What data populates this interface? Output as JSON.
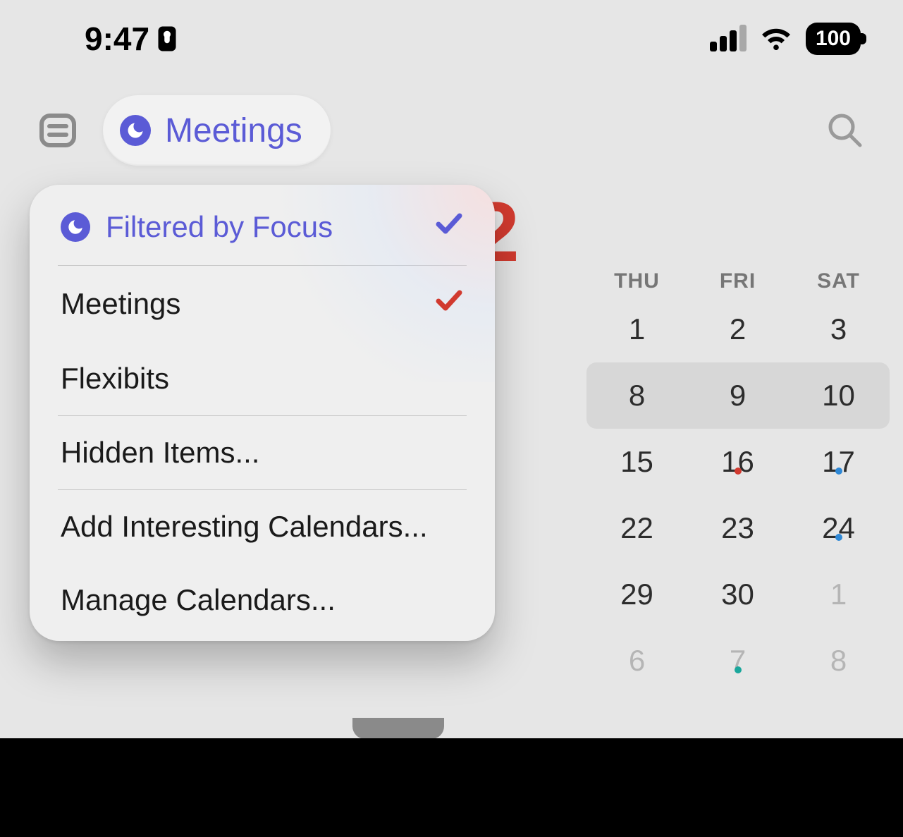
{
  "status": {
    "time": "9:47",
    "battery": "100"
  },
  "header": {
    "pill_label": "Meetings"
  },
  "month": {
    "visible_number": "2"
  },
  "day_headers": [
    "THU",
    "FRI",
    "SAT"
  ],
  "calendar_rows": [
    [
      {
        "num": "1",
        "faded": false,
        "dot": null
      },
      {
        "num": "2",
        "faded": false,
        "dot": null
      },
      {
        "num": "3",
        "faded": false,
        "dot": null
      }
    ],
    [
      {
        "num": "8",
        "faded": false,
        "dot": null
      },
      {
        "num": "9",
        "faded": false,
        "dot": null
      },
      {
        "num": "10",
        "faded": false,
        "dot": null
      }
    ],
    [
      {
        "num": "15",
        "faded": false,
        "dot": null
      },
      {
        "num": "16",
        "faded": false,
        "dot": "red"
      },
      {
        "num": "17",
        "faded": false,
        "dot": "blue"
      }
    ],
    [
      {
        "num": "22",
        "faded": false,
        "dot": null
      },
      {
        "num": "23",
        "faded": false,
        "dot": null
      },
      {
        "num": "24",
        "faded": false,
        "dot": "blue"
      }
    ],
    [
      {
        "num": "29",
        "faded": false,
        "dot": null
      },
      {
        "num": "30",
        "faded": false,
        "dot": null
      },
      {
        "num": "1",
        "faded": true,
        "dot": null
      }
    ],
    [
      {
        "num": "6",
        "faded": true,
        "dot": null
      },
      {
        "num": "7",
        "faded": true,
        "dot": "teal"
      },
      {
        "num": "8",
        "faded": true,
        "dot": null
      }
    ]
  ],
  "popover": {
    "items": [
      {
        "label": "Filtered by Focus",
        "accent": true,
        "icon": "moon",
        "check": "purple"
      },
      {
        "divider": true
      },
      {
        "label": "Meetings",
        "accent": false,
        "icon": null,
        "check": "red"
      },
      {
        "label": "Flexibits",
        "accent": false,
        "icon": null,
        "check": null
      },
      {
        "divider": true
      },
      {
        "label": "Hidden Items...",
        "accent": false,
        "icon": null,
        "check": null
      },
      {
        "divider": true
      },
      {
        "label": "Add Interesting Calendars...",
        "accent": false,
        "icon": null,
        "check": null
      },
      {
        "label": "Manage Calendars...",
        "accent": false,
        "icon": null,
        "check": null
      }
    ]
  }
}
